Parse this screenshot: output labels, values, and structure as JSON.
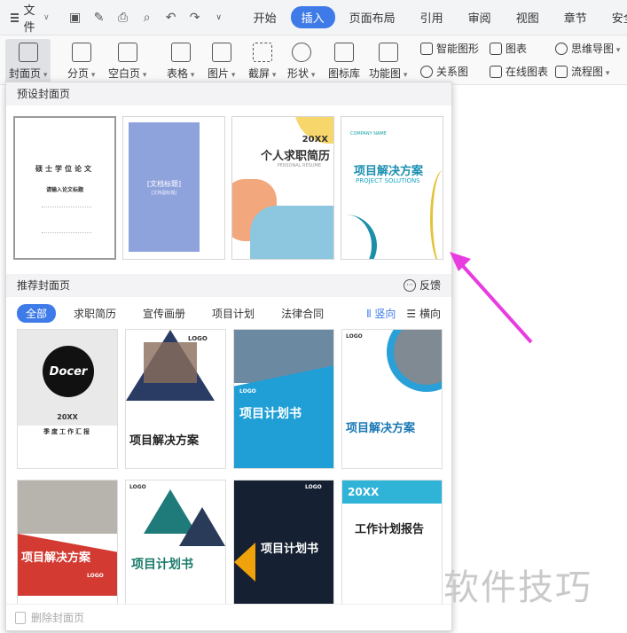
{
  "menubar": {
    "file_label": "文件",
    "tabs": [
      {
        "label": "开始"
      },
      {
        "label": "插入"
      },
      {
        "label": "页面布局"
      },
      {
        "label": "引用"
      },
      {
        "label": "审阅"
      },
      {
        "label": "视图"
      },
      {
        "label": "章节"
      },
      {
        "label": "安全"
      }
    ],
    "active_tab": "插入"
  },
  "ribbon": {
    "cover_page": "封面页",
    "page_break": "分页",
    "blank_page": "空白页",
    "table": "表格",
    "picture": "图片",
    "screenshot": "截屏",
    "shape": "形状",
    "icon_library": "图标库",
    "function_chart": "功能图",
    "smart_art": "智能图形",
    "chart": "图表",
    "relation_chart": "关系图",
    "online_chart": "在线图表",
    "mind_map": "思维导图",
    "flowchart": "流程图"
  },
  "panel": {
    "preset_header": "预设封面页",
    "recommended_header": "推荐封面页",
    "feedback": "反馈",
    "filters": [
      "全部",
      "求职简历",
      "宣传画册",
      "项目计划",
      "法律合同"
    ],
    "orientation": {
      "vertical": "竖向",
      "horizontal": "横向"
    },
    "delete_cover": "删除封面页",
    "presets": [
      {
        "title": "硕士学位论文",
        "subtitle": "请输入论文标题"
      },
      {
        "title": "[文档标题]",
        "subtitle": "[文档副标题]"
      },
      {
        "title": "个人求职简历",
        "year": "20XX",
        "en": "PERSONAL RESUME"
      },
      {
        "title": "项目解决方案",
        "en": "PROJECT SOLUTIONS",
        "company": "COMPANY NAME"
      }
    ],
    "templates": [
      {
        "title": "季度工作汇报",
        "year": "20XX",
        "brand": "Docer"
      },
      {
        "title": "项目解决方案",
        "logo": "LOGO"
      },
      {
        "title": "项目计划书",
        "logo": "LOGO"
      },
      {
        "title": "项目解决方案",
        "logo": "LOGO"
      },
      {
        "title": "项目解决方案",
        "logo": "LOGO"
      },
      {
        "title": "项目计划书",
        "logo": "LOGO"
      },
      {
        "title": "项目计划书",
        "logo": "LOGO"
      },
      {
        "title": "工作计划报告",
        "year": "20XX"
      }
    ]
  },
  "watermark": "软件技巧",
  "colors": {
    "accent": "#3f7be8",
    "arrow": "#e83ce0"
  }
}
